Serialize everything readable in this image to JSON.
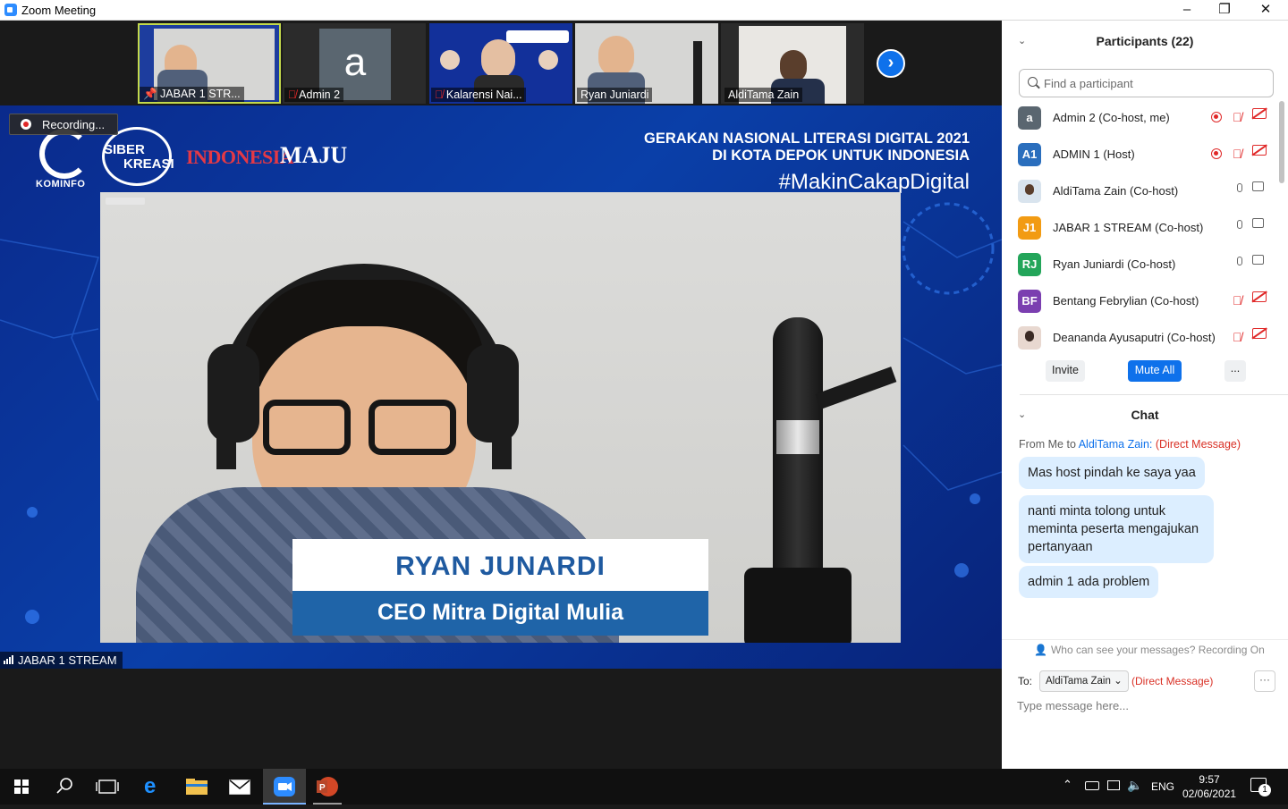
{
  "window": {
    "title": "Zoom Meeting",
    "controls": [
      "–",
      "❐",
      "✕"
    ]
  },
  "thumbnails": [
    {
      "name": "JABAR 1 STR...",
      "muted": false,
      "pinned": true,
      "active": true
    },
    {
      "name": "Admin 2",
      "muted": true,
      "avatar_letter": "a"
    },
    {
      "name": "Kalarensi Nai...",
      "muted": true
    },
    {
      "name": "Ryan Juniardi",
      "muted": false
    },
    {
      "name": "AldiTama Zain",
      "muted": false
    }
  ],
  "recording": {
    "label": "Recording..."
  },
  "banner": {
    "kominfo": "KOMINFO",
    "siber_1": "SIBER",
    "siber_2": "KREASI",
    "indonesia": "INDONESIA",
    "maju": "MAJU",
    "line1": "GERAKAN NASIONAL LITERASI DIGITAL 2021",
    "line2": "DI KOTA DEPOK UNTUK INDONESIA",
    "hashtag": "#MakinCakapDigital"
  },
  "lower_third": {
    "name": "RYAN JUNARDI",
    "role": "CEO Mitra Digital Mulia"
  },
  "speaker_label": "JABAR 1 STREAM",
  "participants": {
    "title": "Participants (22)",
    "search_placeholder": "Find a participant",
    "list": [
      {
        "initials": "a",
        "color": "#5a6670",
        "name": "Admin 2 (Co-host, me)",
        "recording": true,
        "mic": "muted",
        "video": "off"
      },
      {
        "initials": "A1",
        "color": "#2a6ebd",
        "name": "ADMIN 1 (Host)",
        "recording": true,
        "mic": "muted",
        "video": "off"
      },
      {
        "initials": "",
        "color": "#d9e4ee",
        "name": "AldiTama Zain (Co-host)",
        "recording": false,
        "mic": "on",
        "video": "on",
        "photo": true
      },
      {
        "initials": "J1",
        "color": "#f29b13",
        "name": "JABAR 1 STREAM (Co-host)",
        "recording": false,
        "mic": "on",
        "video": "on"
      },
      {
        "initials": "RJ",
        "color": "#23a55a",
        "name": "Ryan Juniardi (Co-host)",
        "recording": false,
        "mic": "on",
        "video": "on"
      },
      {
        "initials": "BF",
        "color": "#7b3fb0",
        "name": "Bentang Febrylian (Co-host)",
        "recording": false,
        "mic": "muted",
        "video": "off"
      },
      {
        "initials": "",
        "color": "#e8d8d0",
        "name": "Deananda Ayusaputri (Co-host)",
        "recording": false,
        "mic": "muted",
        "video": "off",
        "photo": true
      }
    ],
    "invite": "Invite",
    "mute_all": "Mute All",
    "more": "..."
  },
  "chat": {
    "title": "Chat",
    "from_prefix": "From Me to",
    "recipient": "AldiTama Zain:",
    "direct": "(Direct Message)",
    "messages": [
      "Mas host pindah ke saya yaa",
      "nanti minta tolong untuk meminta peserta mengajukan pertanyaan",
      "admin 1 ada problem"
    ],
    "visibility": "Who can see your messages? Recording On",
    "to_label": "To:",
    "to_value": "AldiTama Zain",
    "to_direct": "(Direct Message)",
    "input_placeholder": "Type message here..."
  },
  "taskbar": {
    "lang": "ENG",
    "time": "9:57",
    "date": "02/06/2021",
    "notification_count": "1"
  },
  "colors": {
    "accent": "#0e71eb",
    "danger": "#e02828",
    "link": "#0e71eb",
    "direct": "#d93025"
  }
}
